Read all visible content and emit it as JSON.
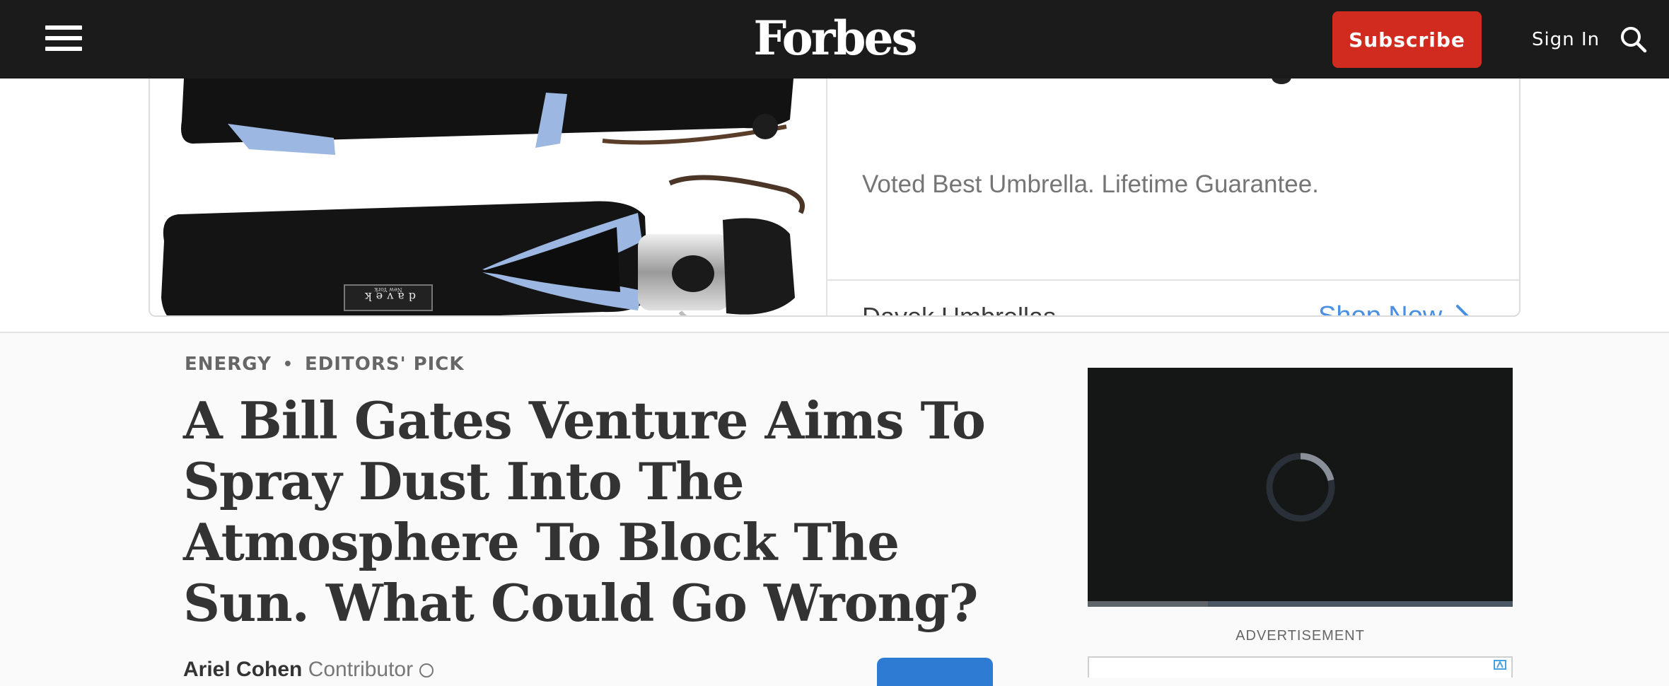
{
  "header": {
    "logo": "Forbes",
    "subscribe_label": "Subscribe",
    "signin_label": "Sign In",
    "colors": {
      "background": "#1b1b1b",
      "subscribe": "#d12b1f"
    }
  },
  "ad_banner": {
    "tagline": "Voted Best Umbrella. Lifetime Guarantee.",
    "brand": "Davek Umbrellas",
    "cta": "Shop Now",
    "product_label": "davek",
    "product_sublabel": "New York",
    "cta_color": "#4a90e2"
  },
  "article": {
    "category": "ENERGY",
    "badge": "EDITORS' PICK",
    "headline": "A Bill Gates Venture Aims To Spray Dust Into The Atmosphere To Block The Sun. What Could Go Wrong?",
    "author": "Ariel Cohen",
    "author_role": "Contributor",
    "follow_color": "#2d7bd3"
  },
  "sidebar": {
    "advertisement_label": "ADVERTISEMENT",
    "video_state": "loading"
  },
  "icons": [
    "menu-icon",
    "search-icon",
    "chevron-right-icon",
    "loading-spinner-icon",
    "adchoices-icon",
    "info-circle-icon"
  ]
}
